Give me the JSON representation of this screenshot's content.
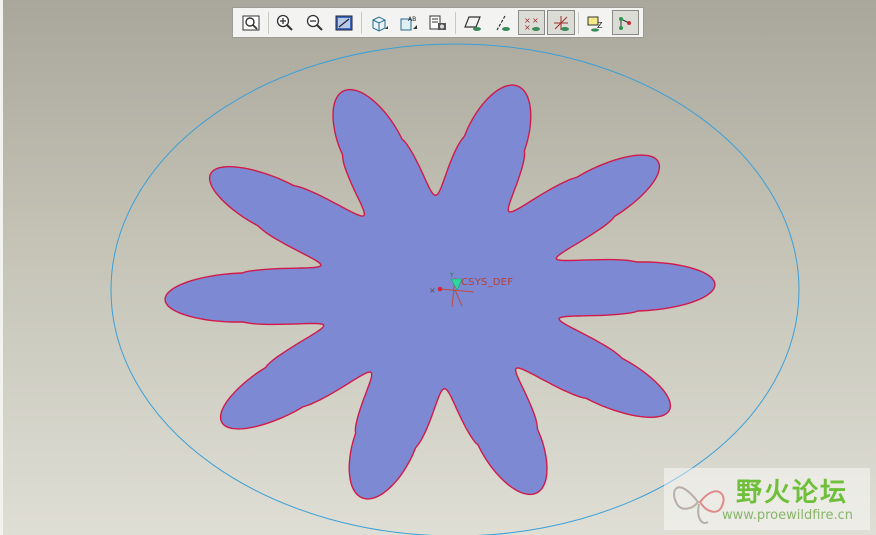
{
  "toolbar": {
    "buttons": [
      {
        "icon": "refit-icon"
      },
      {
        "icon": "zoom-in-icon"
      },
      {
        "icon": "zoom-out-icon"
      },
      {
        "icon": "repaint-icon"
      },
      {
        "icon": "display-style-icon"
      },
      {
        "icon": "saved-views-icon"
      },
      {
        "icon": "layer-snapshot-icon"
      },
      {
        "icon": "datum-planes-icon"
      },
      {
        "icon": "datum-axes-icon"
      },
      {
        "icon": "datum-points-icon",
        "active": true
      },
      {
        "icon": "coordinate-systems-icon",
        "active": true
      },
      {
        "icon": "annotations-icon"
      },
      {
        "icon": "spin-center-icon",
        "active": true
      }
    ]
  },
  "model": {
    "csys_label": "CSYS_DEF",
    "colors": {
      "fill": "#7d89d3",
      "edge": "#d11a4a",
      "circle": "#3aa0d8"
    }
  },
  "watermark": {
    "title": "野火论坛",
    "url": "www.proewildfire.cn"
  }
}
